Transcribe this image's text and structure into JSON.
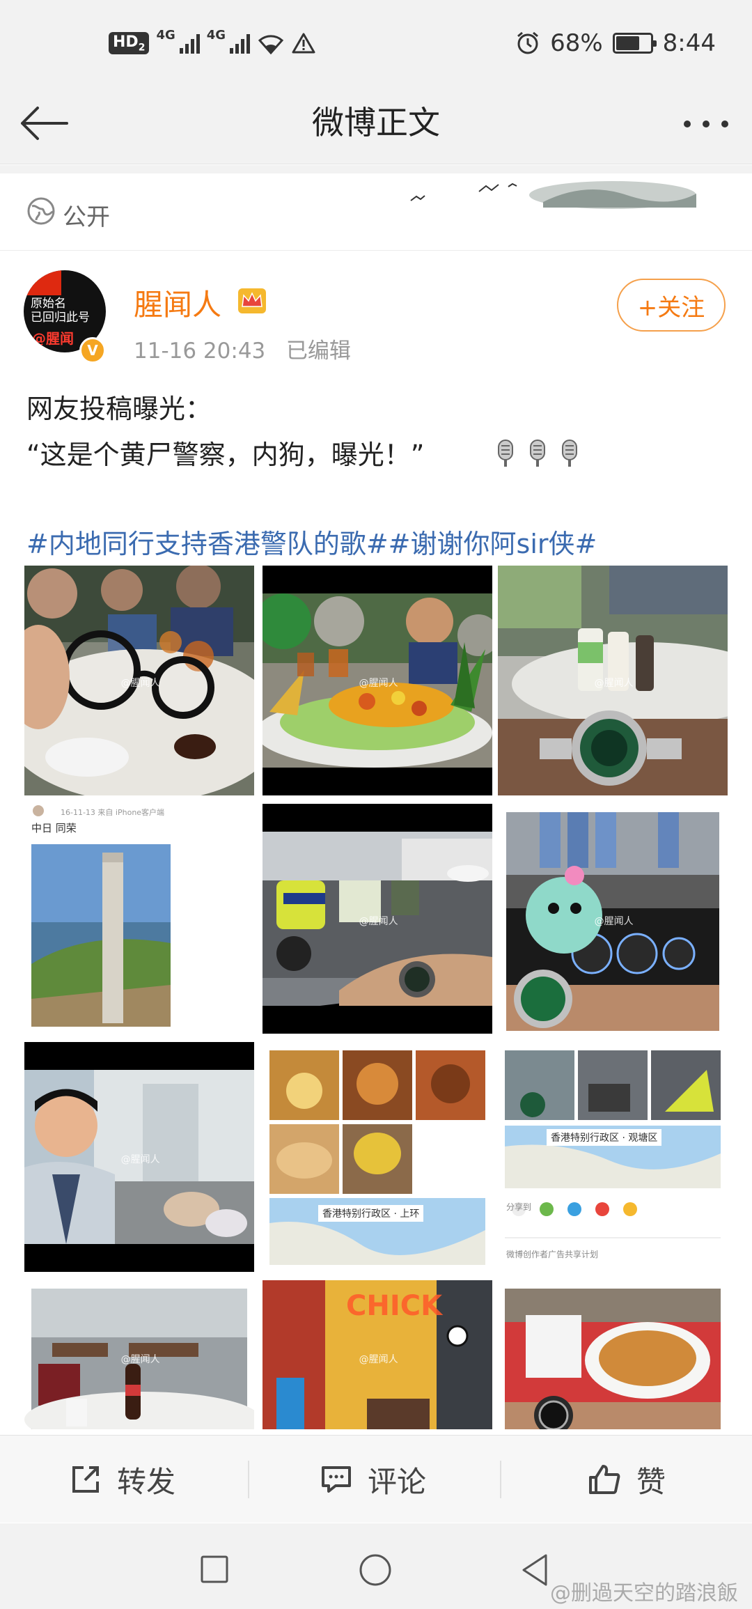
{
  "status_bar": {
    "hd_badge": "HD",
    "hd_sub": "2",
    "network_1": "4G",
    "network_2": "4G",
    "battery_text": "68%",
    "battery_level": 0.68,
    "time": "8:44"
  },
  "title_bar": {
    "title": "微博正文"
  },
  "visibility": {
    "label": "公开"
  },
  "author": {
    "avatar_lines": [
      "原始名",
      "已回归此号"
    ],
    "avatar_handle": "@腥闻",
    "name": "腥闻人",
    "time": "11-16 20:43",
    "edited": "已编辑",
    "follow_label": "+关注"
  },
  "post": {
    "line1": "网友投稿曝光：",
    "line2": "“这是个黄尸警察，内狗，曝光！”",
    "hashtags": "#内地同行支持香港警队的歌##谢谢你阿sir侠#"
  },
  "photo_grid": [
    {
      "name": "photo-glasses-dinner",
      "wm": "@腥闻人"
    },
    {
      "name": "photo-pineapple-dish",
      "wm": "@腥闻人"
    },
    {
      "name": "photo-watch-table",
      "wm": "@腥闻人"
    },
    {
      "name": "photo-monument-screenshot",
      "wm": ""
    },
    {
      "name": "photo-police-motorcycles",
      "wm": "@腥闻人"
    },
    {
      "name": "photo-watch-plush-toy",
      "wm": "@腥闻人"
    },
    {
      "name": "photo-selfie-hallway",
      "wm": "@腥闻人"
    },
    {
      "name": "photo-food-collage-map",
      "wm": ""
    },
    {
      "name": "photo-collage-map",
      "wm": ""
    },
    {
      "name": "photo-canteen",
      "wm": "@腥闻人"
    },
    {
      "name": "photo-restaurant-interior",
      "wm": "@腥闻人"
    },
    {
      "name": "photo-noodles-watch",
      "wm": ""
    }
  ],
  "photo_texts": {
    "monument_header": "中日 同荣",
    "monument_date": "16-11-13 来自 iPhone客户端",
    "map_label_1": "香港特别行政区 · 上环",
    "map_label_2": "香港特别行政区 · 观塘区",
    "share_label": "分享到",
    "ad_label": "微博创作者广告共享计划",
    "chick_sign": "CHICK"
  },
  "actions": {
    "repost": "转发",
    "comment": "评论",
    "like": "赞"
  },
  "watermark": "@删過天空的踏浪飯",
  "colors": {
    "accent_orange": "#f57a12",
    "hashtag_blue": "#3b6bb0",
    "muted_gray": "#999999"
  }
}
